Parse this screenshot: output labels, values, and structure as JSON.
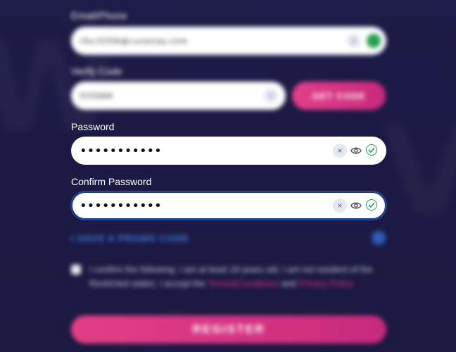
{
  "form": {
    "email": {
      "label": "Email/Phone",
      "value": "r0xr3356@cunenay.com"
    },
    "verify": {
      "label": "Verify Code",
      "value": "555066",
      "button": "GET CODE"
    },
    "password": {
      "label": "Password",
      "value": "•••••••••••"
    },
    "confirm": {
      "label": "Confirm Password",
      "value": "•••••••••••"
    },
    "promo": "I HAVE A PROMO CODE",
    "terms": {
      "text": "I confirm the following: I am at least 18 years old, I am not resident of the Restricted states. I accept the",
      "link1": "Terms&Conditions",
      "and": "and",
      "link2": "Privacy Policy"
    },
    "register": "REGISTER"
  },
  "colors": {
    "background": "#1c1a44",
    "accent_pink": "#e33f88",
    "success_green": "#22a04b",
    "link_blue": "#3f7fe0"
  }
}
